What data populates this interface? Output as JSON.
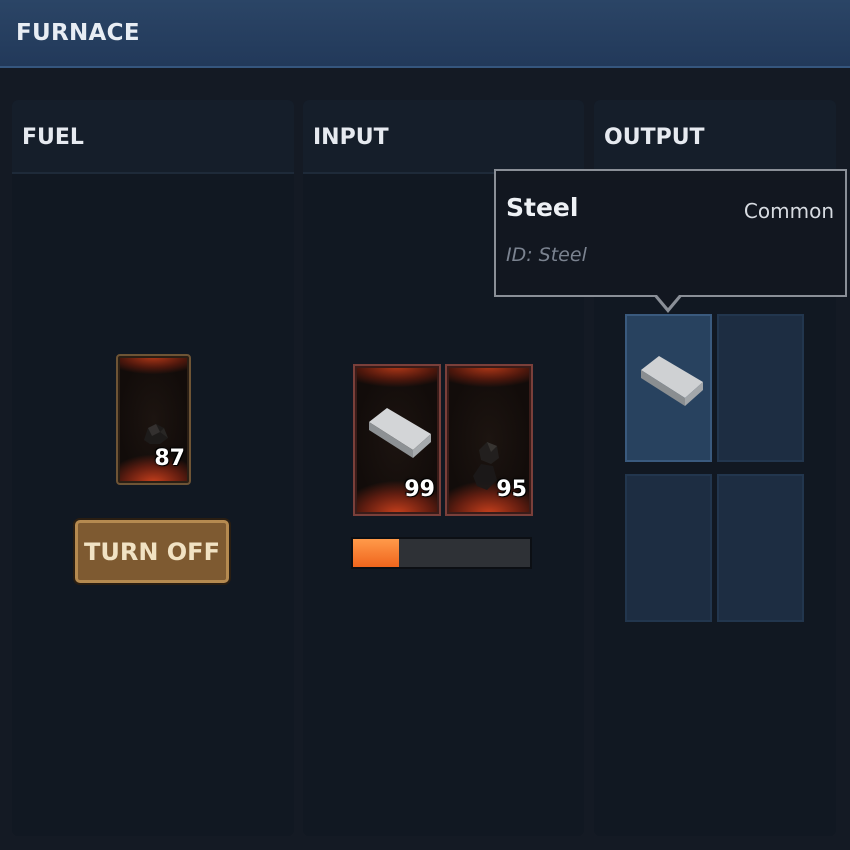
{
  "window": {
    "title": "FURNACE"
  },
  "fuel": {
    "title": "FUEL",
    "slot": {
      "item_icon": "coal-icon",
      "count": "87"
    },
    "toggle_label": "TURN OFF"
  },
  "input": {
    "title": "INPUT",
    "slots": [
      {
        "item_icon": "steel-bar-icon",
        "count": "99"
      },
      {
        "item_icon": "coal-icon",
        "count": "95"
      }
    ],
    "progress": 0.26
  },
  "output": {
    "title": "OUTPUT",
    "slots": [
      {
        "item_icon": "steel-bar-icon",
        "selected": true
      },
      {
        "item_icon": null
      },
      {
        "item_icon": null
      },
      {
        "item_icon": null
      }
    ]
  },
  "tooltip": {
    "name": "Steel",
    "rarity": "Common",
    "id_text": "ID: Steel"
  },
  "colors": {
    "title_bar": "#22395a",
    "panel": "#111822",
    "button": "#7e5a31",
    "progress_fill": "#f0651d",
    "fire": "#c8401c",
    "output_slot": "#1d2d42"
  }
}
